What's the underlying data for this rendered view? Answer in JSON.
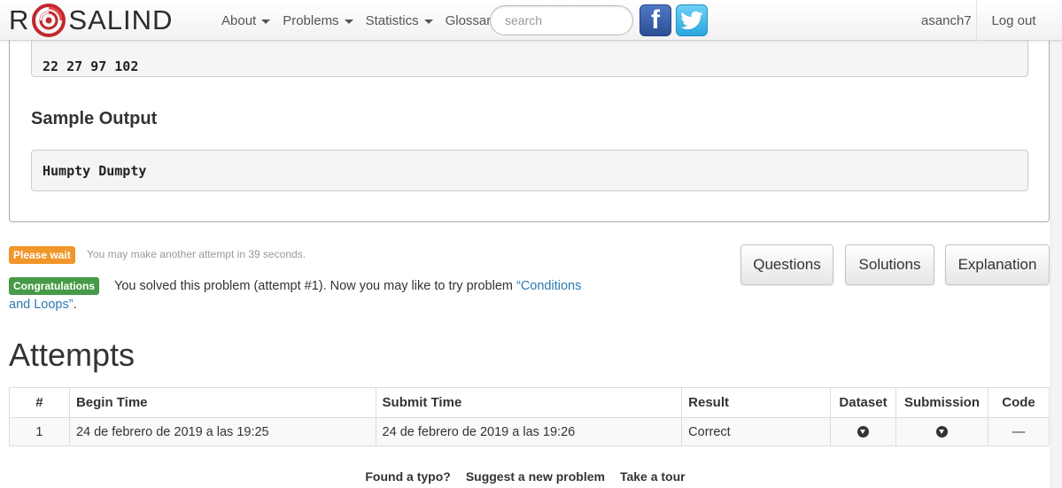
{
  "navbar": {
    "brand_left": "R",
    "brand_right": "SALIND",
    "menu": [
      {
        "label": "About",
        "dropdown": true
      },
      {
        "label": "Problems",
        "dropdown": true
      },
      {
        "label": "Statistics",
        "dropdown": true
      },
      {
        "label": "Glossary",
        "dropdown": false
      }
    ],
    "search_placeholder": "search",
    "facebook_glyph": "f",
    "username": "asanch7",
    "logout": "Log out"
  },
  "problem": {
    "sample_input_tail": "22 27 97 102",
    "sample_output_title": "Sample Output",
    "sample_output": "Humpty Dumpty"
  },
  "status": {
    "wait_label": "Please wait",
    "wait_text": "You may make another attempt in 39 seconds.",
    "congrats_label": "Congratulations",
    "congrats_text": "You solved this problem (attempt #1). Now you may like to try problem ",
    "next_problem_link": "“Conditions and Loops”",
    "congrats_end": "."
  },
  "buttons": {
    "questions": "Questions",
    "solutions": "Solutions",
    "explanation": "Explanation"
  },
  "attempts": {
    "title": "Attempts",
    "columns": [
      "#",
      "Begin Time",
      "Submit Time",
      "Result",
      "Dataset",
      "Submission",
      "Code"
    ],
    "rows": [
      {
        "num": "1",
        "begin": "24 de febrero de 2019 a las 19:25",
        "submit": "24 de febrero de 2019 a las 19:26",
        "result": "Correct",
        "code": "—"
      }
    ]
  },
  "footer": {
    "links": [
      "Found a typo?",
      "Suggest a new problem",
      "Take a tour"
    ]
  },
  "colors": {
    "wait": "#f0962a",
    "success": "#479a47",
    "link": "#2a7ab0",
    "logo_red": "#c0282d"
  }
}
